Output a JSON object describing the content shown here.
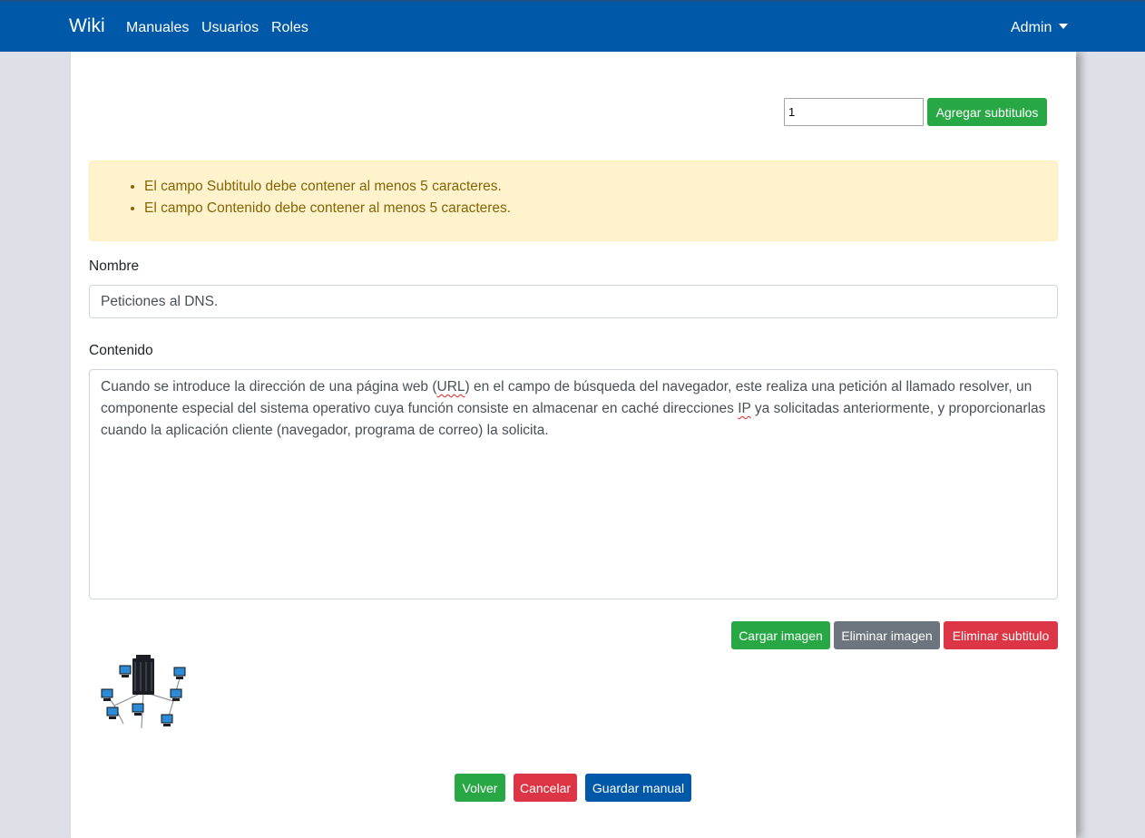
{
  "navbar": {
    "brand": "Wiki",
    "links": [
      "Manuales",
      "Usuarios",
      "Roles"
    ],
    "user": "Admin"
  },
  "subtitles": {
    "count_value": "1",
    "add_button": "Agregar subtitulos"
  },
  "alert": {
    "errors": [
      "El campo Subtitulo debe contener al menos 5 caracteres.",
      "El campo Contenido debe contener al menos 5 caracteres."
    ]
  },
  "form": {
    "name_label": "Nombre",
    "name_value": "Peticiones al DNS.",
    "content_label": "Contenido",
    "content_parts": [
      "Cuando se introduce la dirección de una página web (",
      "URL",
      ") en el campo de búsqueda del navegador, este realiza una petición al llamado resolver, un componente especial del sistema operativo cuya función consiste en almacenar en caché direcciones ",
      "IP",
      " ya solicitadas anteriormente, y proporcionarlas cuando la aplicación cliente (navegador, programa de correo) la solicita."
    ]
  },
  "image_actions": {
    "upload": "Cargar imagen",
    "delete_image": "Eliminar imagen",
    "delete_subtitle": "Eliminar subtitulo"
  },
  "footer_actions": {
    "back": "Volver",
    "cancel": "Cancelar",
    "save": "Guardar manual"
  },
  "colors": {
    "navbar": "#0059a8",
    "success": "#28a745",
    "danger": "#dc3545",
    "secondary": "#6c757d",
    "warning_bg": "#fff3cd",
    "warning_text": "#856404"
  },
  "icons": [
    "dropdown-caret-icon"
  ]
}
